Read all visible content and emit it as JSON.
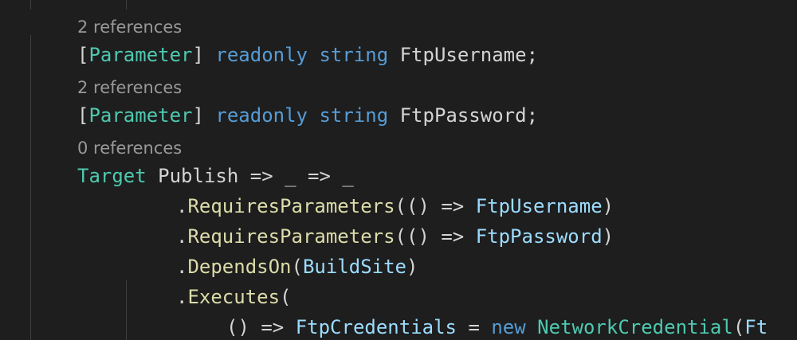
{
  "codelens": {
    "ftp_username_refs": "2 references",
    "ftp_password_refs": "2 references",
    "publish_refs": "0 references"
  },
  "code": {
    "line_username": {
      "open_bracket": "[",
      "attribute": "Parameter",
      "close_bracket": "] ",
      "kw_readonly": "readonly",
      "space1": " ",
      "kw_string": "string",
      "space2": " ",
      "field_name": "FtpUsername",
      "semicolon": ";"
    },
    "line_password": {
      "open_bracket": "[",
      "attribute": "Parameter",
      "close_bracket": "] ",
      "kw_readonly": "readonly",
      "space1": " ",
      "kw_string": "string",
      "space2": " ",
      "field_name": "FtpPassword",
      "semicolon": ";"
    },
    "line_target": {
      "type": "Target",
      "rest": " Publish => _ => _"
    },
    "line_requires_user": {
      "dot": ".",
      "method": "RequiresParameters",
      "open": "(() => ",
      "arg": "FtpUsername",
      "close": ")"
    },
    "line_requires_pass": {
      "dot": ".",
      "method": "RequiresParameters",
      "open": "(() => ",
      "arg": "FtpPassword",
      "close": ")"
    },
    "line_depends": {
      "dot": ".",
      "method": "DependsOn",
      "open": "(",
      "arg": "BuildSite",
      "close": ")"
    },
    "line_executes": {
      "dot": ".",
      "method": "Executes",
      "open": "("
    },
    "line_lambda": {
      "open": "() => ",
      "ident": "FtpCredentials",
      "assign": " = ",
      "kw_new": "new",
      "space": " ",
      "type": "NetworkCredential",
      "open_paren": "(",
      "cut_ident": "Ft"
    }
  }
}
